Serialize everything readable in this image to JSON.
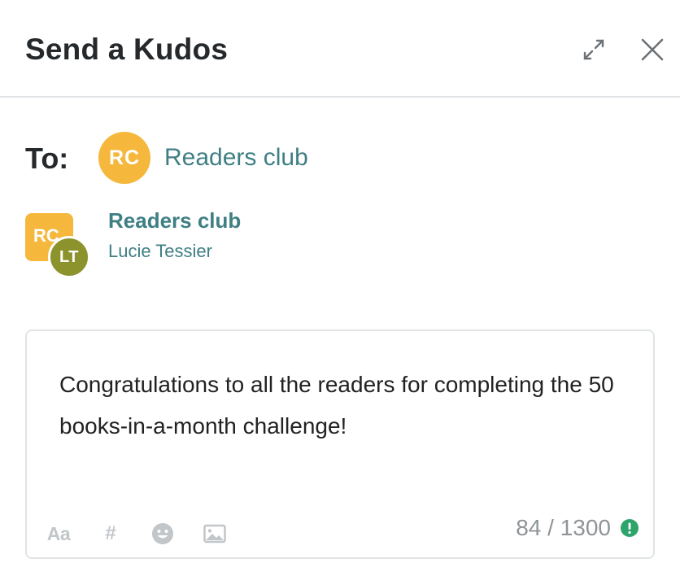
{
  "header": {
    "title": "Send a Kudos",
    "expand_icon": "expand-arrows-icon",
    "close_icon": "close-icon"
  },
  "to": {
    "label": "To:",
    "chip": {
      "initials": "RC",
      "name": "Readers club",
      "color": "#f5b83d"
    }
  },
  "recipient": {
    "space_initials": "RC",
    "user_initials": "LT",
    "space_name": "Readers club",
    "user_name": "Lucie Tessier",
    "space_color": "#f5b83d",
    "user_color": "#8c932c"
  },
  "editor": {
    "message": "Congratulations to all the readers for completing the 50 books-in-a-month challenge!",
    "counter": "84 / 1300",
    "toolbar": [
      {
        "label": "Aa",
        "icon": "text-format-icon"
      },
      {
        "label": "#",
        "icon": "hashtag-icon"
      },
      {
        "icon": "emoji-icon"
      },
      {
        "icon": "image-icon"
      }
    ],
    "status_color": "#2ea36b"
  },
  "colors": {
    "accent": "#3f7f84",
    "title": "#26292c",
    "muted": "#c2c6c9"
  }
}
